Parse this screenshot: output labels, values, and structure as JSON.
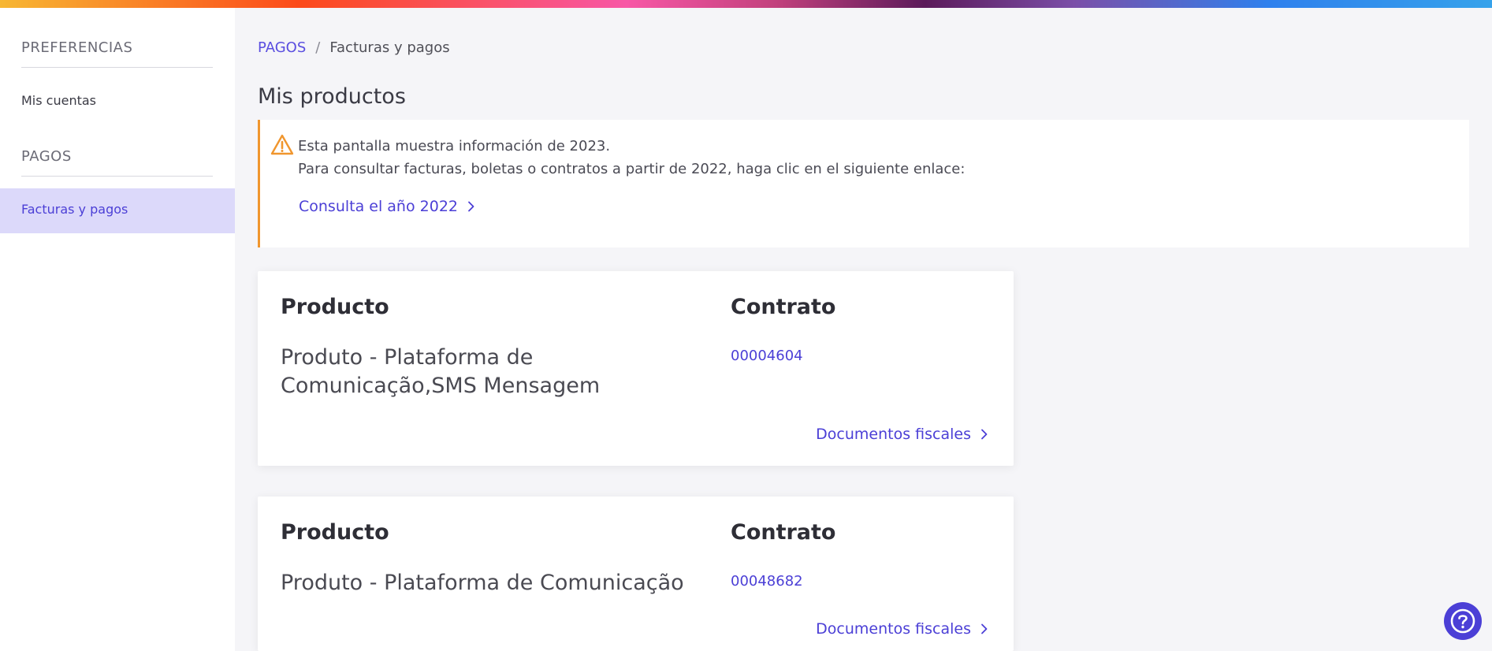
{
  "sidebar": {
    "section1": "PREFERENCIAS",
    "item_accounts": "Mis cuentas",
    "section2": "PAGOS",
    "item_invoices": "Facturas y pagos"
  },
  "breadcrumb": {
    "root": "PAGOS",
    "separator": "/",
    "current": "Facturas y pagos"
  },
  "page_title": "Mis productos",
  "notice": {
    "line1": "Esta pantalla muestra información de 2023.",
    "line2": "Para consultar facturas, boletas o contratos a partir de 2022, haga clic en el siguiente enlace:",
    "link": "Consulta el año 2022",
    "icon": "warning-icon",
    "accent": "#f0962e"
  },
  "cards": [
    {
      "product_header": "Producto",
      "contract_header": "Contrato",
      "product": "Produto - Plataforma de Comunicação,SMS Mensagem",
      "contract": "00004604",
      "docs_link": "Documentos fiscales"
    },
    {
      "product_header": "Producto",
      "contract_header": "Contrato",
      "product": "Produto - Plataforma de Comunicação",
      "contract": "00048682",
      "docs_link": "Documentos fiscales"
    }
  ],
  "help": {
    "icon": "help-icon"
  },
  "colors": {
    "accent": "#4b3fd6",
    "active_bg": "#dcd9fa",
    "warning": "#f0962e"
  }
}
